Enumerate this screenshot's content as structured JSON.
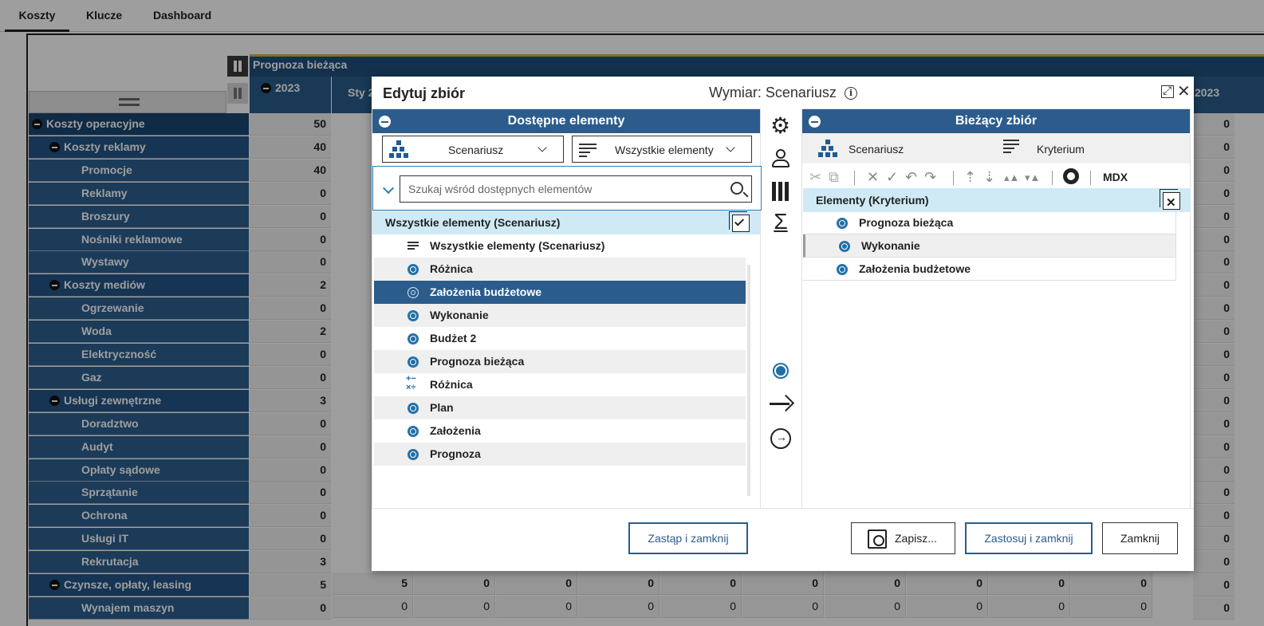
{
  "tabs": [
    {
      "label": "Koszty",
      "active": true
    },
    {
      "label": "Klucze",
      "active": false
    },
    {
      "label": "Dashboard",
      "active": false
    }
  ],
  "grid": {
    "header_band": "Prognoza bieżąca",
    "year_label": "2023",
    "month_label": "Sty 2",
    "right_year_label": "2023",
    "rows": [
      {
        "label": "Koszty operacyjne",
        "level": 1,
        "value": "50",
        "right": "0"
      },
      {
        "label": "Koszty reklamy",
        "level": 2,
        "value": "40",
        "right": "0"
      },
      {
        "label": "Promocje",
        "level": 3,
        "value": "40",
        "right": "0"
      },
      {
        "label": "Reklamy",
        "level": 3,
        "value": "0",
        "right": "0"
      },
      {
        "label": "Broszury",
        "level": 3,
        "value": "0",
        "right": "0"
      },
      {
        "label": "Nośniki reklamowe",
        "level": 3,
        "value": "0",
        "right": "0"
      },
      {
        "label": "Wystawy",
        "level": 3,
        "value": "0",
        "right": "0"
      },
      {
        "label": "Koszty mediów",
        "level": 2,
        "value": "2",
        "right": "0"
      },
      {
        "label": "Ogrzewanie",
        "level": 3,
        "value": "0",
        "right": "0"
      },
      {
        "label": "Woda",
        "level": 3,
        "value": "2",
        "right": "0"
      },
      {
        "label": "Elektryczność",
        "level": 3,
        "value": "0",
        "right": "0"
      },
      {
        "label": "Gaz",
        "level": 3,
        "value": "0",
        "right": "0"
      },
      {
        "label": "Usługi zewnętrzne",
        "level": 2,
        "value": "3",
        "right": "0"
      },
      {
        "label": "Doradztwo",
        "level": 3,
        "value": "0",
        "right": "0"
      },
      {
        "label": "Audyt",
        "level": 3,
        "value": "0",
        "right": "0"
      },
      {
        "label": "Opłaty sądowe",
        "level": 3,
        "value": "0",
        "right": "0"
      },
      {
        "label": "Sprzątanie",
        "level": 3,
        "value": "0",
        "right": "0"
      },
      {
        "label": "Ochrona",
        "level": 3,
        "value": "0",
        "right": "0"
      },
      {
        "label": "Usługi IT",
        "level": 3,
        "value": "0",
        "right": "0"
      },
      {
        "label": "Rekrutacja",
        "level": 3,
        "value": "3",
        "right": "0"
      },
      {
        "label": "Czynsze, opłaty, leasing",
        "level": 2,
        "value": "5",
        "right": "0"
      },
      {
        "label": "Wynajem maszyn",
        "level": 3,
        "value": "0",
        "right": "0"
      }
    ],
    "bottom_row_a": [
      "5",
      "0",
      "0",
      "0",
      "0",
      "0",
      "0",
      "0",
      "0",
      "0"
    ],
    "bottom_row_b": [
      "0",
      "0",
      "0",
      "0",
      "0",
      "0",
      "0",
      "0",
      "0",
      "0"
    ]
  },
  "dialog": {
    "title": "Edytuj zbiór",
    "dimension": "Wymiar: Scenariusz",
    "available": {
      "header": "Dostępne elementy",
      "hierarchy_dropdown": "Scenariusz",
      "filter_dropdown": "Wszystkie elementy",
      "search_placeholder": "Szukaj wśród dostępnych elementów",
      "group_header": "Wszystkie elementy (Scenariusz)",
      "items": [
        {
          "label": "Wszystkie elementy (Scenariusz)",
          "icon": "filter"
        },
        {
          "label": "Różnica",
          "icon": "member"
        },
        {
          "label": "Założenia budżetowe",
          "icon": "member",
          "selected": true
        },
        {
          "label": "Wykonanie",
          "icon": "member"
        },
        {
          "label": "Budżet 2",
          "icon": "member"
        },
        {
          "label": "Prognoza bieżąca",
          "icon": "member"
        },
        {
          "label": "Różnica",
          "icon": "calc"
        },
        {
          "label": "Plan",
          "icon": "member"
        },
        {
          "label": "Założenia",
          "icon": "member"
        },
        {
          "label": "Prognoza",
          "icon": "member"
        }
      ]
    },
    "current": {
      "header": "Bieżący zbiór",
      "hierarchy_label": "Scenariusz",
      "criteria_label": "Kryterium",
      "mdx_label": "MDX",
      "group_header": "Elementy (Kryterium)",
      "items": [
        "Prognoza bieżąca",
        "Wykonanie",
        "Założenia budżetowe"
      ]
    },
    "buttons": {
      "replace_close": "Zastąp i zamknij",
      "save": "Zapisz...",
      "apply_close": "Zastosuj i zamknij",
      "close": "Zamknij"
    }
  },
  "colors": {
    "header_blue": "#2b5c8c",
    "row_blue": "#1f4f7d",
    "highlight_cyan": "#cfeaf5",
    "member_dot": "#1f6fa8",
    "accent_gold": "#d6b23b"
  }
}
